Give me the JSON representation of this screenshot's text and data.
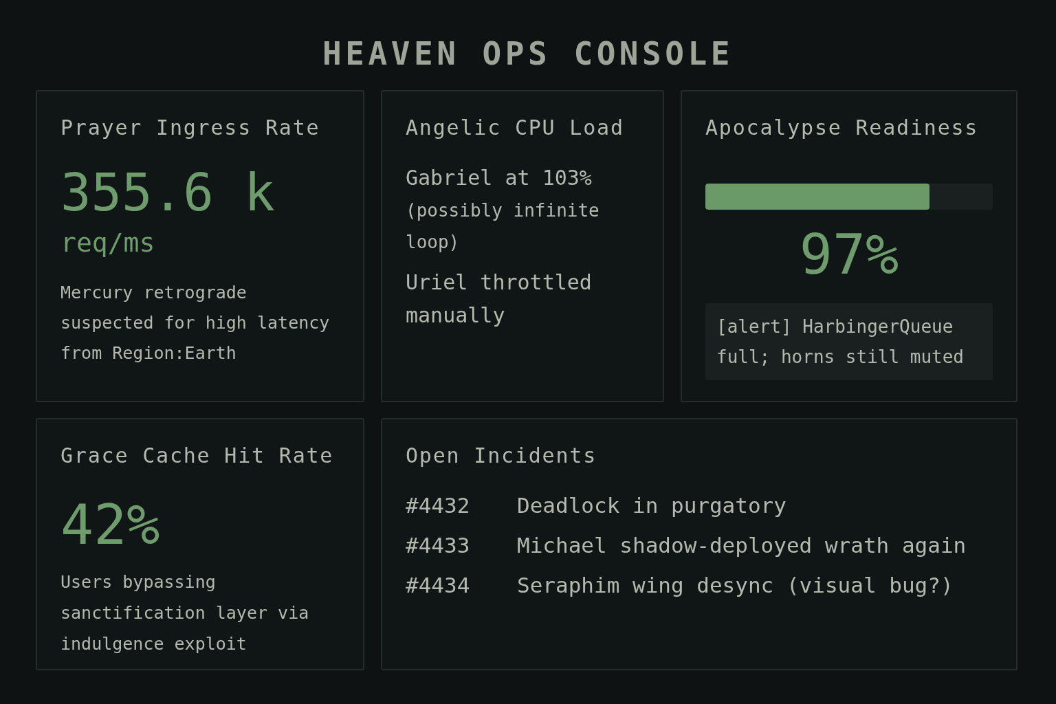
{
  "title": "HEAVEN OPS CONSOLE",
  "prayer_ingress": {
    "title": "Prayer Ingress Rate",
    "value": "355.6 k",
    "unit": "req/ms",
    "note": "Mercury retrograde suspected for high latency from Region:Earth"
  },
  "cpu_load": {
    "title": "Angelic CPU Load",
    "lines": [
      {
        "text": "Gabriel at 103%",
        "detail": "(possibly infinite loop)"
      },
      {
        "text": "Uriel throttled manually"
      }
    ]
  },
  "apocalypse": {
    "title": "Apocalypse Readiness",
    "level": 0.78,
    "value": "97%",
    "alert": "[alert] HarbingerQueue full; horns still muted"
  },
  "grace_cache": {
    "title": "Grace Cache Hit Rate",
    "value": "42%",
    "note": "Users bypassing sanctification layer via indulgence exploit"
  },
  "incidents": {
    "title": "Open Incidents",
    "rows": [
      {
        "id": "#4432",
        "text": "Deadlock in purgatory"
      },
      {
        "id": "#4433",
        "text": "Michael shadow-deployed wrath again"
      },
      {
        "id": "#4434",
        "text": "Seraphim wing desync (visual bug?)"
      }
    ]
  }
}
